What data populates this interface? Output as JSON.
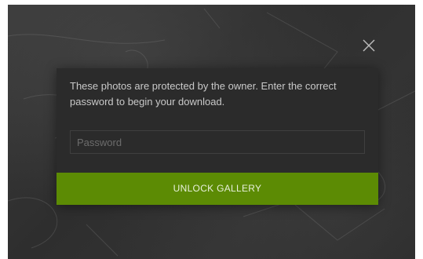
{
  "dialog": {
    "message": "These photos are protected by the owner. Enter the correct password to begin your download.",
    "password": {
      "value": "",
      "placeholder": "Password"
    },
    "unlock_label": "UNLOCK GALLERY"
  },
  "icons": {
    "close": "close-icon"
  },
  "colors": {
    "accent": "#5c8b04",
    "dialog_background": "#2b2b2b",
    "overlay": "#333333"
  }
}
